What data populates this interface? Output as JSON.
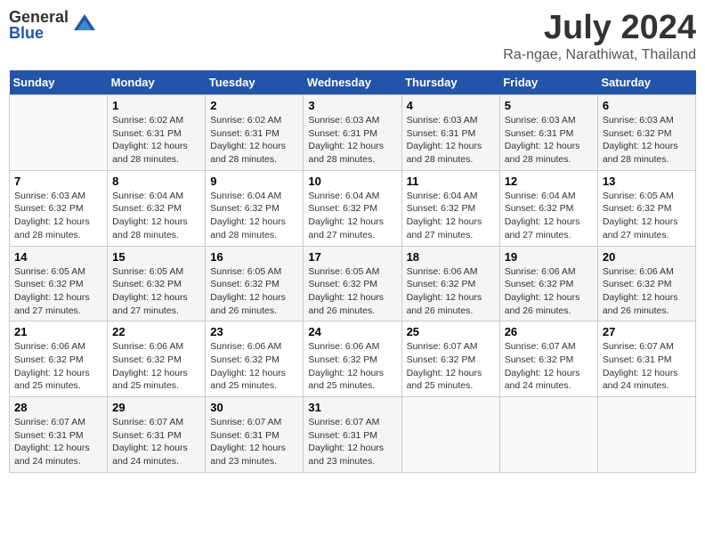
{
  "logo": {
    "general": "General",
    "blue": "Blue"
  },
  "title": "July 2024",
  "subtitle": "Ra-ngae, Narathiwat, Thailand",
  "days_of_week": [
    "Sunday",
    "Monday",
    "Tuesday",
    "Wednesday",
    "Thursday",
    "Friday",
    "Saturday"
  ],
  "weeks": [
    [
      {
        "day": "",
        "sunrise": "",
        "sunset": "",
        "daylight": ""
      },
      {
        "day": "1",
        "sunrise": "Sunrise: 6:02 AM",
        "sunset": "Sunset: 6:31 PM",
        "daylight": "Daylight: 12 hours and 28 minutes."
      },
      {
        "day": "2",
        "sunrise": "Sunrise: 6:02 AM",
        "sunset": "Sunset: 6:31 PM",
        "daylight": "Daylight: 12 hours and 28 minutes."
      },
      {
        "day": "3",
        "sunrise": "Sunrise: 6:03 AM",
        "sunset": "Sunset: 6:31 PM",
        "daylight": "Daylight: 12 hours and 28 minutes."
      },
      {
        "day": "4",
        "sunrise": "Sunrise: 6:03 AM",
        "sunset": "Sunset: 6:31 PM",
        "daylight": "Daylight: 12 hours and 28 minutes."
      },
      {
        "day": "5",
        "sunrise": "Sunrise: 6:03 AM",
        "sunset": "Sunset: 6:31 PM",
        "daylight": "Daylight: 12 hours and 28 minutes."
      },
      {
        "day": "6",
        "sunrise": "Sunrise: 6:03 AM",
        "sunset": "Sunset: 6:32 PM",
        "daylight": "Daylight: 12 hours and 28 minutes."
      }
    ],
    [
      {
        "day": "7",
        "sunrise": "Sunrise: 6:03 AM",
        "sunset": "Sunset: 6:32 PM",
        "daylight": "Daylight: 12 hours and 28 minutes."
      },
      {
        "day": "8",
        "sunrise": "Sunrise: 6:04 AM",
        "sunset": "Sunset: 6:32 PM",
        "daylight": "Daylight: 12 hours and 28 minutes."
      },
      {
        "day": "9",
        "sunrise": "Sunrise: 6:04 AM",
        "sunset": "Sunset: 6:32 PM",
        "daylight": "Daylight: 12 hours and 28 minutes."
      },
      {
        "day": "10",
        "sunrise": "Sunrise: 6:04 AM",
        "sunset": "Sunset: 6:32 PM",
        "daylight": "Daylight: 12 hours and 27 minutes."
      },
      {
        "day": "11",
        "sunrise": "Sunrise: 6:04 AM",
        "sunset": "Sunset: 6:32 PM",
        "daylight": "Daylight: 12 hours and 27 minutes."
      },
      {
        "day": "12",
        "sunrise": "Sunrise: 6:04 AM",
        "sunset": "Sunset: 6:32 PM",
        "daylight": "Daylight: 12 hours and 27 minutes."
      },
      {
        "day": "13",
        "sunrise": "Sunrise: 6:05 AM",
        "sunset": "Sunset: 6:32 PM",
        "daylight": "Daylight: 12 hours and 27 minutes."
      }
    ],
    [
      {
        "day": "14",
        "sunrise": "Sunrise: 6:05 AM",
        "sunset": "Sunset: 6:32 PM",
        "daylight": "Daylight: 12 hours and 27 minutes."
      },
      {
        "day": "15",
        "sunrise": "Sunrise: 6:05 AM",
        "sunset": "Sunset: 6:32 PM",
        "daylight": "Daylight: 12 hours and 27 minutes."
      },
      {
        "day": "16",
        "sunrise": "Sunrise: 6:05 AM",
        "sunset": "Sunset: 6:32 PM",
        "daylight": "Daylight: 12 hours and 26 minutes."
      },
      {
        "day": "17",
        "sunrise": "Sunrise: 6:05 AM",
        "sunset": "Sunset: 6:32 PM",
        "daylight": "Daylight: 12 hours and 26 minutes."
      },
      {
        "day": "18",
        "sunrise": "Sunrise: 6:06 AM",
        "sunset": "Sunset: 6:32 PM",
        "daylight": "Daylight: 12 hours and 26 minutes."
      },
      {
        "day": "19",
        "sunrise": "Sunrise: 6:06 AM",
        "sunset": "Sunset: 6:32 PM",
        "daylight": "Daylight: 12 hours and 26 minutes."
      },
      {
        "day": "20",
        "sunrise": "Sunrise: 6:06 AM",
        "sunset": "Sunset: 6:32 PM",
        "daylight": "Daylight: 12 hours and 26 minutes."
      }
    ],
    [
      {
        "day": "21",
        "sunrise": "Sunrise: 6:06 AM",
        "sunset": "Sunset: 6:32 PM",
        "daylight": "Daylight: 12 hours and 25 minutes."
      },
      {
        "day": "22",
        "sunrise": "Sunrise: 6:06 AM",
        "sunset": "Sunset: 6:32 PM",
        "daylight": "Daylight: 12 hours and 25 minutes."
      },
      {
        "day": "23",
        "sunrise": "Sunrise: 6:06 AM",
        "sunset": "Sunset: 6:32 PM",
        "daylight": "Daylight: 12 hours and 25 minutes."
      },
      {
        "day": "24",
        "sunrise": "Sunrise: 6:06 AM",
        "sunset": "Sunset: 6:32 PM",
        "daylight": "Daylight: 12 hours and 25 minutes."
      },
      {
        "day": "25",
        "sunrise": "Sunrise: 6:07 AM",
        "sunset": "Sunset: 6:32 PM",
        "daylight": "Daylight: 12 hours and 25 minutes."
      },
      {
        "day": "26",
        "sunrise": "Sunrise: 6:07 AM",
        "sunset": "Sunset: 6:32 PM",
        "daylight": "Daylight: 12 hours and 24 minutes."
      },
      {
        "day": "27",
        "sunrise": "Sunrise: 6:07 AM",
        "sunset": "Sunset: 6:31 PM",
        "daylight": "Daylight: 12 hours and 24 minutes."
      }
    ],
    [
      {
        "day": "28",
        "sunrise": "Sunrise: 6:07 AM",
        "sunset": "Sunset: 6:31 PM",
        "daylight": "Daylight: 12 hours and 24 minutes."
      },
      {
        "day": "29",
        "sunrise": "Sunrise: 6:07 AM",
        "sunset": "Sunset: 6:31 PM",
        "daylight": "Daylight: 12 hours and 24 minutes."
      },
      {
        "day": "30",
        "sunrise": "Sunrise: 6:07 AM",
        "sunset": "Sunset: 6:31 PM",
        "daylight": "Daylight: 12 hours and 23 minutes."
      },
      {
        "day": "31",
        "sunrise": "Sunrise: 6:07 AM",
        "sunset": "Sunset: 6:31 PM",
        "daylight": "Daylight: 12 hours and 23 minutes."
      },
      {
        "day": "",
        "sunrise": "",
        "sunset": "",
        "daylight": ""
      },
      {
        "day": "",
        "sunrise": "",
        "sunset": "",
        "daylight": ""
      },
      {
        "day": "",
        "sunrise": "",
        "sunset": "",
        "daylight": ""
      }
    ]
  ]
}
